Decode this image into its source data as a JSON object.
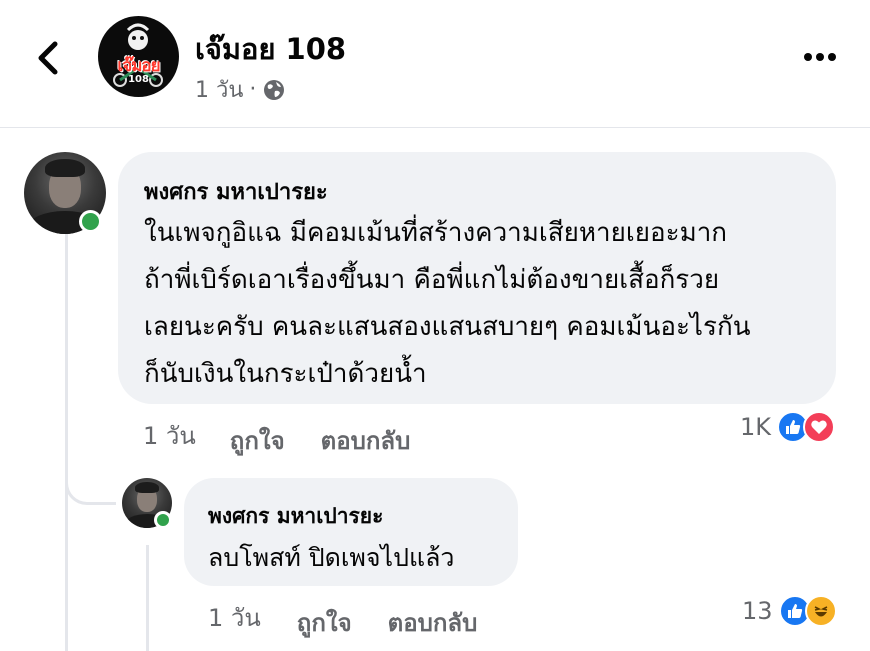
{
  "header": {
    "page_name": "เจ๊มอย 108",
    "avatar_logo_text": "เจ๊มอย",
    "avatar_logo_num": "108",
    "time": "1 วัน",
    "dot": "·",
    "privacy_icon": "globe-icon",
    "back_icon": "chevron-left-icon",
    "more_icon": "more-horizontal-icon"
  },
  "comments": [
    {
      "author": "พงศกร มหาเปารยะ",
      "lines": [
        "ในเพจกูอิแฉ มีคอมเม้นที่สร้างความเสียหายเยอะมาก",
        "ถ้าพี่เบิร์ดเอาเรื่องขึ้นมา คือพี่แกไม่ต้องขายเสื้อก็รวย",
        "เลยนะครับ คนละแสนสองแสนสบายๆ คอมเม้นอะไรกัน",
        "ก็นับเงินในกระเป๋าด้วยน้ำ"
      ],
      "time": "1 วัน",
      "like_label": "ถูกใจ",
      "reply_label": "ตอบกลับ",
      "reaction_count": "1K",
      "reactions": [
        "like",
        "love"
      ]
    },
    {
      "author": "พงศกร มหาเปารยะ",
      "lines": [
        "ลบโพสท์ ปิดเพจไปแล้ว"
      ],
      "time": "1 วัน",
      "like_label": "ถูกใจ",
      "reply_label": "ตอบกลับ",
      "reaction_count": "13",
      "reactions": [
        "like",
        "haha"
      ]
    }
  ],
  "colors": {
    "bubble": "#f0f2f5",
    "secondary_text": "#65676b",
    "online": "#31a24c",
    "like_blue": "#1877f2",
    "love_red": "#f33e58",
    "haha_yellow": "#f7b125"
  }
}
